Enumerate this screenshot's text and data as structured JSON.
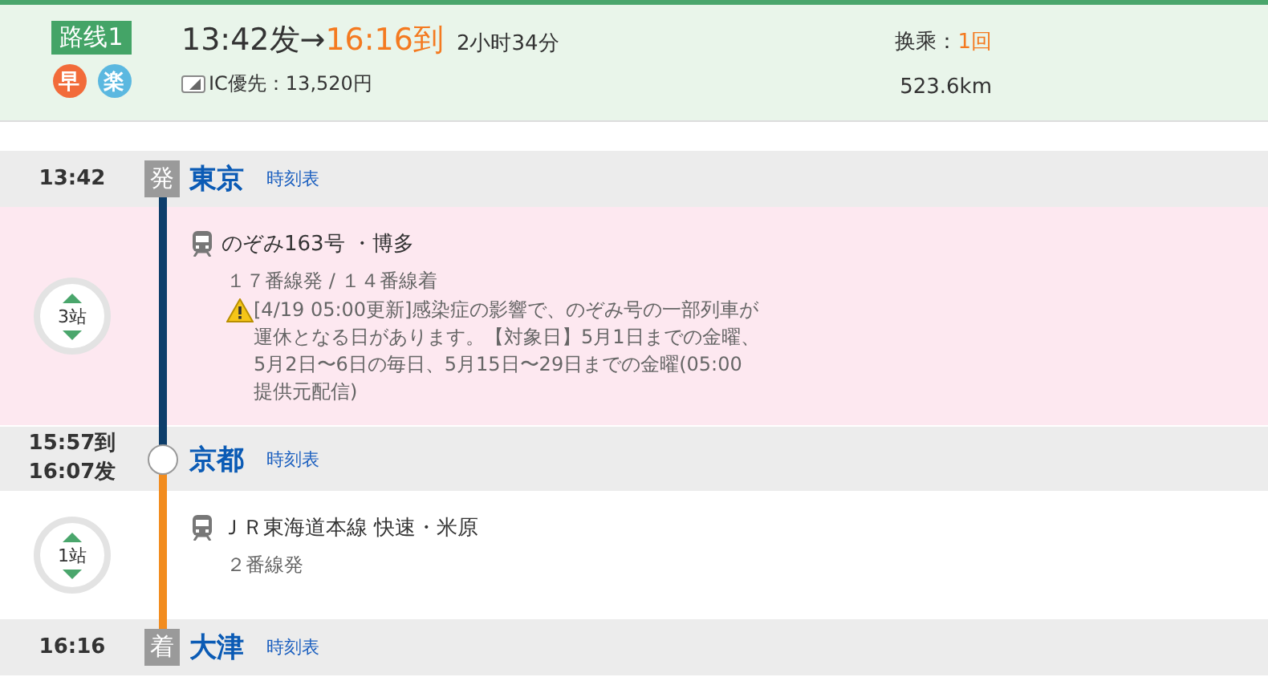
{
  "route": {
    "label": "路线1",
    "badges": [
      {
        "text": "早",
        "color": "#f26b3a"
      },
      {
        "text": "楽",
        "color": "#5bb8e0"
      }
    ],
    "departure": "13:42发",
    "arrow": "→",
    "arrival": "16:16到",
    "duration": "2小时34分",
    "fare": "IC優先：13,520円",
    "transfers_label": "换乘：",
    "transfers": "1回",
    "distance": "523.6km"
  },
  "timeline": [
    {
      "kind": "station",
      "times": [
        "13:42"
      ],
      "badge": "発",
      "name": "東京",
      "link": "時刻表"
    },
    {
      "kind": "segment",
      "highlighted": true,
      "color": "#0d3e6b",
      "stops": "3站",
      "train": "のぞみ163号 ・博多",
      "platform": "１７番線発 / １４番線着",
      "notice": "[4/19 05:00更新]感染症の影響で、のぞみ号の一部列車が運休となる日があります。【対象日】5月1日までの金曜、5月2日〜6日の毎日、5月15日〜29日までの金曜(05:00 提供元配信)"
    },
    {
      "kind": "station",
      "times": [
        "15:57到",
        "16:07发"
      ],
      "name": "京都",
      "link": "時刻表"
    },
    {
      "kind": "segment",
      "highlighted": false,
      "color": "#f28c1e",
      "stops": "1站",
      "train": "ＪＲ東海道本線 快速・米原",
      "platform": "２番線発"
    },
    {
      "kind": "station",
      "times": [
        "16:16"
      ],
      "badge": "着",
      "name": "大津",
      "link": "時刻表"
    }
  ]
}
